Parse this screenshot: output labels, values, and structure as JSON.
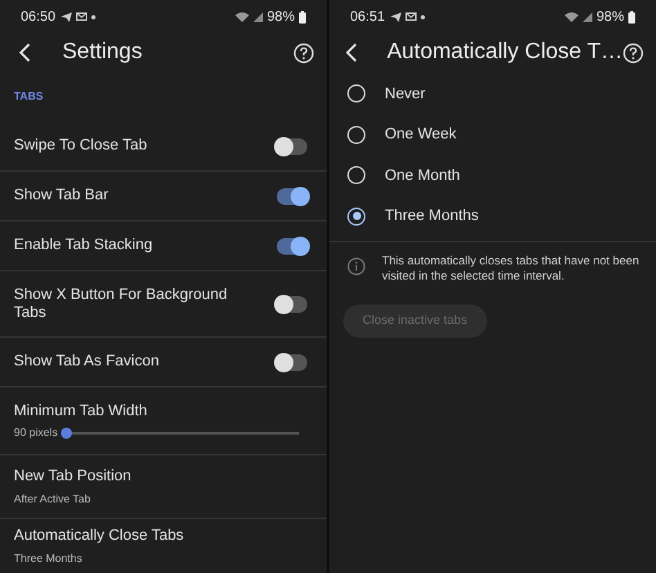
{
  "settings_screen": {
    "status_bar": {
      "time": "06:50",
      "battery": "98%"
    },
    "title": "Settings",
    "section": "TABS",
    "items": [
      {
        "kind": "toggle",
        "label": "Swipe To Close Tab",
        "on": false
      },
      {
        "kind": "toggle",
        "label": "Show Tab Bar",
        "on": true
      },
      {
        "kind": "toggle",
        "label": "Enable Tab Stacking",
        "on": true
      },
      {
        "kind": "toggle",
        "label": "Show X Button For Background Tabs",
        "on": false
      },
      {
        "kind": "toggle",
        "label": "Show Tab As Favicon",
        "on": false
      },
      {
        "kind": "slider",
        "label": "Minimum Tab Width",
        "value": "90 pixels",
        "level": 0
      },
      {
        "kind": "value",
        "label": "New Tab Position",
        "value": "After Active Tab"
      },
      {
        "kind": "value",
        "label": "Automatically Close Tabs",
        "value": "Three Months"
      }
    ]
  },
  "close_tabs_screen": {
    "status_bar": {
      "time": "06:51",
      "battery": "98%"
    },
    "title": "Automatically Close T…",
    "options": [
      {
        "label": "Never",
        "selected": false
      },
      {
        "label": "One Week",
        "selected": false
      },
      {
        "label": "One Month",
        "selected": false
      },
      {
        "label": "Three Months",
        "selected": true
      }
    ],
    "info": "This automatically closes tabs that have not been visited in the selected time interval.",
    "button": {
      "label": "Close inactive tabs",
      "disabled": true
    }
  }
}
